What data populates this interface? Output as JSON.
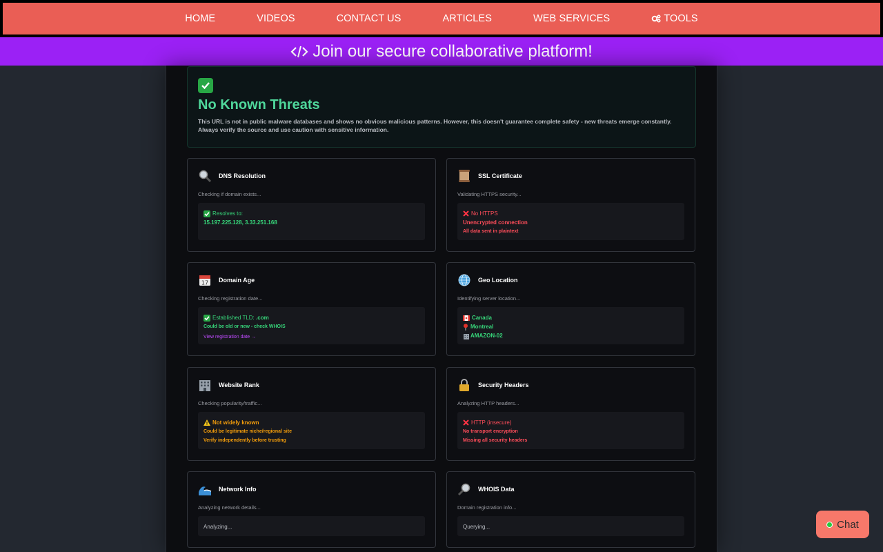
{
  "nav": {
    "home": "HOME",
    "videos": "VIDEOS",
    "contact": "CONTACT US",
    "articles": "ARTICLES",
    "web_services": "WEB SERVICES",
    "tools": "TOOLS"
  },
  "promo": {
    "text": "Join our secure collaborative platform!"
  },
  "verdict": {
    "title": "No Known Threats",
    "description": "This URL is not in public malware databases and shows no obvious malicious patterns. However, this doesn't guarantee complete safety - new threats emerge constantly. Always verify the source and use caution with sensitive information."
  },
  "cards": {
    "dns": {
      "title": "DNS Resolution",
      "subtitle": "Checking if domain exists...",
      "line1": "Resolves to:",
      "line2": "15.197.225.128, 3.33.251.168"
    },
    "ssl": {
      "title": "SSL Certificate",
      "subtitle": "Validating HTTPS security...",
      "line1": "No HTTPS",
      "line2": "Unencrypted connection",
      "line3": "All data sent in plaintext"
    },
    "age": {
      "title": "Domain Age",
      "subtitle": "Checking registration date...",
      "line1_prefix": "Established TLD:",
      "line1_value": ".com",
      "line2": "Could be old or new - check WHOIS",
      "line3": "View registration date →"
    },
    "geo": {
      "title": "Geo Location",
      "subtitle": "Identifying server location...",
      "country": "Canada",
      "city": "Montreal",
      "org": "AMAZON-02"
    },
    "rank": {
      "title": "Website Rank",
      "subtitle": "Checking popularity/traffic...",
      "line1": "Not widely known",
      "line2": "Could be legitimate niche/regional site",
      "line3": "Verify independently before trusting"
    },
    "headers": {
      "title": "Security Headers",
      "subtitle": "Analyzing HTTP headers...",
      "line1": "HTTP (insecure)",
      "line2": "No transport encryption",
      "line3": "Missing all security headers"
    },
    "network": {
      "title": "Network Info",
      "subtitle": "Analyzing network details...",
      "status": "Analyzing..."
    },
    "whois": {
      "title": "WHOIS Data",
      "subtitle": "Domain registration info...",
      "status": "Querying..."
    }
  },
  "chat": {
    "label": "Chat"
  },
  "colors": {
    "nav_bg": "#ea5e55",
    "promo_bg": "#9b21f5",
    "ok_green": "#37d67a",
    "danger_red": "#ff4d5a",
    "warn_orange": "#f59e0b",
    "link_purple": "#c04bff"
  },
  "icons": {
    "tools": "gears-icon",
    "promo": "code-icon",
    "verdict": "check-mark-icon",
    "dns": "magnifier-icon",
    "ssl": "scroll-icon",
    "age": "calendar-icon",
    "geo": "globe-icon",
    "rank": "building-icon",
    "headers": "lock-icon",
    "network": "wave-icon",
    "whois": "magnifier-right-icon"
  }
}
